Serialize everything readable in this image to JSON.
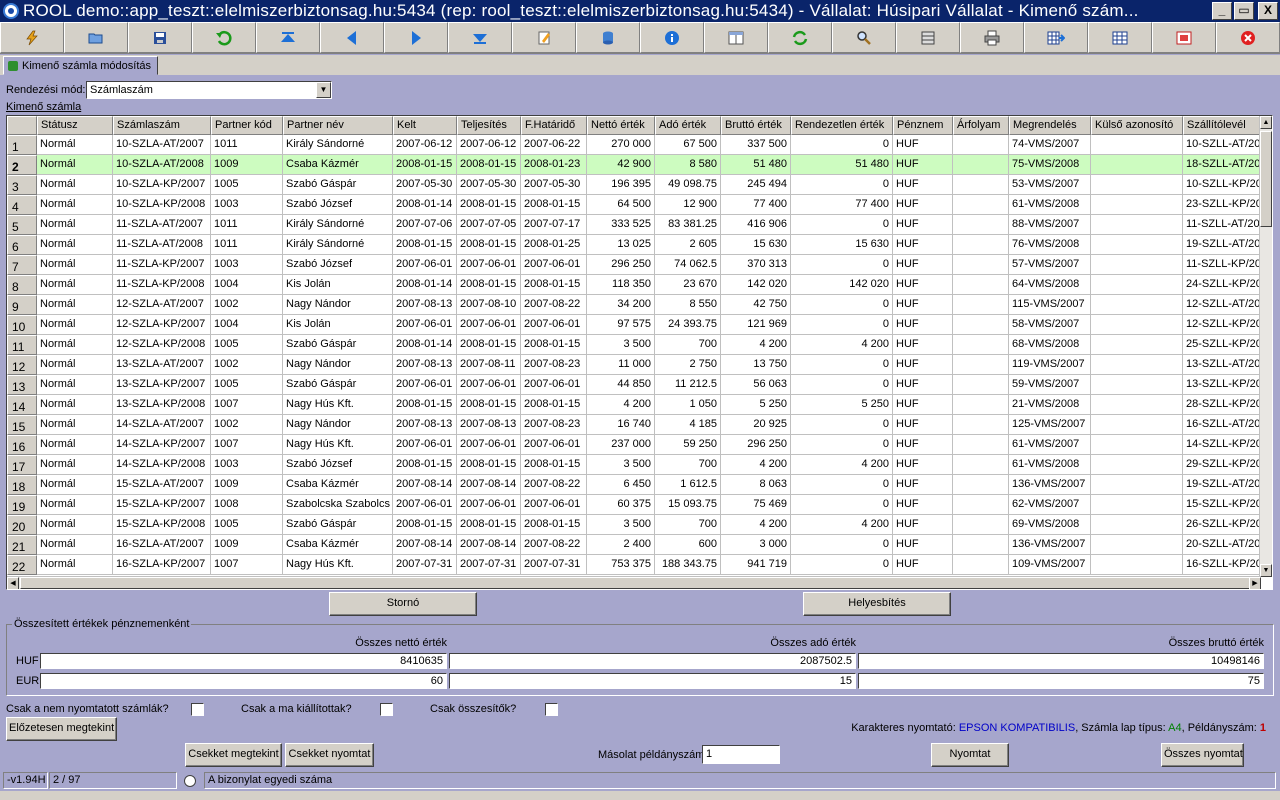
{
  "window": {
    "title": "ROOL demo::app_teszt::elelmiszerbiztonsag.hu:5434 (rep: rool_teszt::elelmiszerbiztonsag.hu:5434) - Vállalat: Húsipari Vállalat - Kimenő szám...",
    "min": "_",
    "max": "▭",
    "close": "X"
  },
  "toolbar": {
    "icons": [
      "lightning-icon",
      "folder-open-icon",
      "save-icon",
      "undo-icon",
      "first-record-icon",
      "previous-icon",
      "next-icon",
      "last-record-icon",
      "edit-icon",
      "database-icon",
      "info-icon",
      "layout-icon",
      "refresh-icon",
      "search-icon",
      "filter-icon",
      "print-icon",
      "grid-export-icon",
      "grid-icon",
      "fullscreen-icon",
      "exit-icon"
    ]
  },
  "tab": {
    "label": "Kimenő számla módosítás"
  },
  "sort": {
    "label": "Rendezési mód:",
    "value": "Számlaszám"
  },
  "grid": {
    "caption": "Kimenő számla",
    "columns": [
      "Státusz",
      "Számlaszám",
      "Partner kód",
      "Partner név",
      "Kelt",
      "Teljesítés",
      "F.Határidő",
      "Nettó érték",
      "Adó érték",
      "Bruttó érték",
      "Rendezetlen érték",
      "Pénznem",
      "Árfolyam",
      "Megrendelés",
      "Külső azonosító",
      "Szállítólevél"
    ],
    "selected_row": 2,
    "rows": [
      [
        "1",
        "Normál",
        "10-SZLA-AT/2007",
        "1011",
        "Király Sándorné",
        "2007-06-12",
        "2007-06-12",
        "2007-06-22",
        "270 000",
        "67 500",
        "337 500",
        "0",
        "HUF",
        "",
        "74-VMS/2007",
        "",
        "10-SZLL-AT/20"
      ],
      [
        "2",
        "Normál",
        "10-SZLA-AT/2008",
        "1009",
        "Csaba Kázmér",
        "2008-01-15",
        "2008-01-15",
        "2008-01-23",
        "42 900",
        "8 580",
        "51 480",
        "51 480",
        "HUF",
        "",
        "75-VMS/2008",
        "",
        "18-SZLL-AT/20"
      ],
      [
        "3",
        "Normál",
        "10-SZLA-KP/2007",
        "1005",
        "Szabó Gáspár",
        "2007-05-30",
        "2007-05-30",
        "2007-05-30",
        "196 395",
        "49 098.75",
        "245 494",
        "0",
        "HUF",
        "",
        "53-VMS/2007",
        "",
        "10-SZLL-KP/20"
      ],
      [
        "4",
        "Normál",
        "10-SZLA-KP/2008",
        "1003",
        "Szabó József",
        "2008-01-14",
        "2008-01-15",
        "2008-01-15",
        "64 500",
        "12 900",
        "77 400",
        "77 400",
        "HUF",
        "",
        "61-VMS/2008",
        "",
        "23-SZLL-KP/20"
      ],
      [
        "5",
        "Normál",
        "11-SZLA-AT/2007",
        "1011",
        "Király Sándorné",
        "2007-07-06",
        "2007-07-05",
        "2007-07-17",
        "333 525",
        "83 381.25",
        "416 906",
        "0",
        "HUF",
        "",
        "88-VMS/2007",
        "",
        "11-SZLL-AT/20"
      ],
      [
        "6",
        "Normál",
        "11-SZLA-AT/2008",
        "1011",
        "Király Sándorné",
        "2008-01-15",
        "2008-01-15",
        "2008-01-25",
        "13 025",
        "2 605",
        "15 630",
        "15 630",
        "HUF",
        "",
        "76-VMS/2008",
        "",
        "19-SZLL-AT/20"
      ],
      [
        "7",
        "Normál",
        "11-SZLA-KP/2007",
        "1003",
        "Szabó József",
        "2007-06-01",
        "2007-06-01",
        "2007-06-01",
        "296 250",
        "74 062.5",
        "370 313",
        "0",
        "HUF",
        "",
        "57-VMS/2007",
        "",
        "11-SZLL-KP/20"
      ],
      [
        "8",
        "Normál",
        "11-SZLA-KP/2008",
        "1004",
        "Kis Jolán",
        "2008-01-14",
        "2008-01-15",
        "2008-01-15",
        "118 350",
        "23 670",
        "142 020",
        "142 020",
        "HUF",
        "",
        "64-VMS/2008",
        "",
        "24-SZLL-KP/20"
      ],
      [
        "9",
        "Normál",
        "12-SZLA-AT/2007",
        "1002",
        "Nagy Nándor",
        "2007-08-13",
        "2007-08-10",
        "2007-08-22",
        "34 200",
        "8 550",
        "42 750",
        "0",
        "HUF",
        "",
        "115-VMS/2007",
        "",
        "12-SZLL-AT/20"
      ],
      [
        "10",
        "Normál",
        "12-SZLA-KP/2007",
        "1004",
        "Kis Jolán",
        "2007-06-01",
        "2007-06-01",
        "2007-06-01",
        "97 575",
        "24 393.75",
        "121 969",
        "0",
        "HUF",
        "",
        "58-VMS/2007",
        "",
        "12-SZLL-KP/20"
      ],
      [
        "11",
        "Normál",
        "12-SZLA-KP/2008",
        "1005",
        "Szabó Gáspár",
        "2008-01-14",
        "2008-01-15",
        "2008-01-15",
        "3 500",
        "700",
        "4 200",
        "4 200",
        "HUF",
        "",
        "68-VMS/2008",
        "",
        "25-SZLL-KP/20"
      ],
      [
        "12",
        "Normál",
        "13-SZLA-AT/2007",
        "1002",
        "Nagy Nándor",
        "2007-08-13",
        "2007-08-11",
        "2007-08-23",
        "11 000",
        "2 750",
        "13 750",
        "0",
        "HUF",
        "",
        "119-VMS/2007",
        "",
        "13-SZLL-AT/20"
      ],
      [
        "13",
        "Normál",
        "13-SZLA-KP/2007",
        "1005",
        "Szabó Gáspár",
        "2007-06-01",
        "2007-06-01",
        "2007-06-01",
        "44 850",
        "11 212.5",
        "56 063",
        "0",
        "HUF",
        "",
        "59-VMS/2007",
        "",
        "13-SZLL-KP/20"
      ],
      [
        "14",
        "Normál",
        "13-SZLA-KP/2008",
        "1007",
        "Nagy Hús Kft.",
        "2008-01-15",
        "2008-01-15",
        "2008-01-15",
        "4 200",
        "1 050",
        "5 250",
        "5 250",
        "HUF",
        "",
        "21-VMS/2008",
        "",
        "28-SZLL-KP/20"
      ],
      [
        "15",
        "Normál",
        "14-SZLA-AT/2007",
        "1002",
        "Nagy Nándor",
        "2007-08-13",
        "2007-08-13",
        "2007-08-23",
        "16 740",
        "4 185",
        "20 925",
        "0",
        "HUF",
        "",
        "125-VMS/2007",
        "",
        "16-SZLL-AT/20"
      ],
      [
        "16",
        "Normál",
        "14-SZLA-KP/2007",
        "1007",
        "Nagy Hús Kft.",
        "2007-06-01",
        "2007-06-01",
        "2007-06-01",
        "237 000",
        "59 250",
        "296 250",
        "0",
        "HUF",
        "",
        "61-VMS/2007",
        "",
        "14-SZLL-KP/20"
      ],
      [
        "17",
        "Normál",
        "14-SZLA-KP/2008",
        "1003",
        "Szabó József",
        "2008-01-15",
        "2008-01-15",
        "2008-01-15",
        "3 500",
        "700",
        "4 200",
        "4 200",
        "HUF",
        "",
        "61-VMS/2008",
        "",
        "29-SZLL-KP/20"
      ],
      [
        "18",
        "Normál",
        "15-SZLA-AT/2007",
        "1009",
        "Csaba Kázmér",
        "2007-08-14",
        "2007-08-14",
        "2007-08-22",
        "6 450",
        "1 612.5",
        "8 063",
        "0",
        "HUF",
        "",
        "136-VMS/2007",
        "",
        "19-SZLL-AT/20"
      ],
      [
        "19",
        "Normál",
        "15-SZLA-KP/2007",
        "1008",
        "Szabolcska Szabolcs",
        "2007-06-01",
        "2007-06-01",
        "2007-06-01",
        "60 375",
        "15 093.75",
        "75 469",
        "0",
        "HUF",
        "",
        "62-VMS/2007",
        "",
        "15-SZLL-KP/20"
      ],
      [
        "20",
        "Normál",
        "15-SZLA-KP/2008",
        "1005",
        "Szabó Gáspár",
        "2008-01-15",
        "2008-01-15",
        "2008-01-15",
        "3 500",
        "700",
        "4 200",
        "4 200",
        "HUF",
        "",
        "69-VMS/2008",
        "",
        "26-SZLL-KP/20"
      ],
      [
        "21",
        "Normál",
        "16-SZLA-AT/2007",
        "1009",
        "Csaba Kázmér",
        "2007-08-14",
        "2007-08-14",
        "2007-08-22",
        "2 400",
        "600",
        "3 000",
        "0",
        "HUF",
        "",
        "136-VMS/2007",
        "",
        "20-SZLL-AT/20"
      ],
      [
        "22",
        "Normál",
        "16-SZLA-KP/2007",
        "1007",
        "Nagy Hús Kft.",
        "2007-07-31",
        "2007-07-31",
        "2007-07-31",
        "753 375",
        "188 343.75",
        "941 719",
        "0",
        "HUF",
        "",
        "109-VMS/2007",
        "",
        "16-SZLL-KP/20"
      ]
    ]
  },
  "actions": {
    "storno": "Stornó",
    "correction": "Helyesbítés"
  },
  "summary": {
    "legend": "Összesített értékek pénznemenként",
    "net_label": "Összes nettó érték",
    "tax_label": "Összes adó érték",
    "gross_label": "Összes bruttó érték",
    "huf": {
      "label": "HUF",
      "net": "8410635",
      "tax": "2087502.5",
      "gross": "10498146"
    },
    "eur": {
      "label": "EUR",
      "net": "60",
      "tax": "15",
      "gross": "75"
    }
  },
  "filters": {
    "unprinted": "Csak a nem nyomtatott számlák?",
    "today": "Csak a ma kiállítottak?",
    "summaries": "Csak összesítők?"
  },
  "preview_button": "Előzetesen megtekint",
  "printer": {
    "label": "Karakteres nyomtató:",
    "name": "EPSON KOMPATIBILIS",
    "sheet_label": ", Számla lap típus:",
    "sheet": "A4",
    "copies_label": ", Példányszám:",
    "copies": "1"
  },
  "bottom_actions": {
    "view_checks": "Csekket megtekint",
    "print_checks": "Csekket nyomtat",
    "copies_label": "Másolat példányszám:",
    "copies_value": "1",
    "print": "Nyomtat",
    "print_all": "Összes nyomtat"
  },
  "status": {
    "version": "-v1.94H",
    "record": "2 / 97",
    "hint": "A bizonylat egyedi száma"
  }
}
